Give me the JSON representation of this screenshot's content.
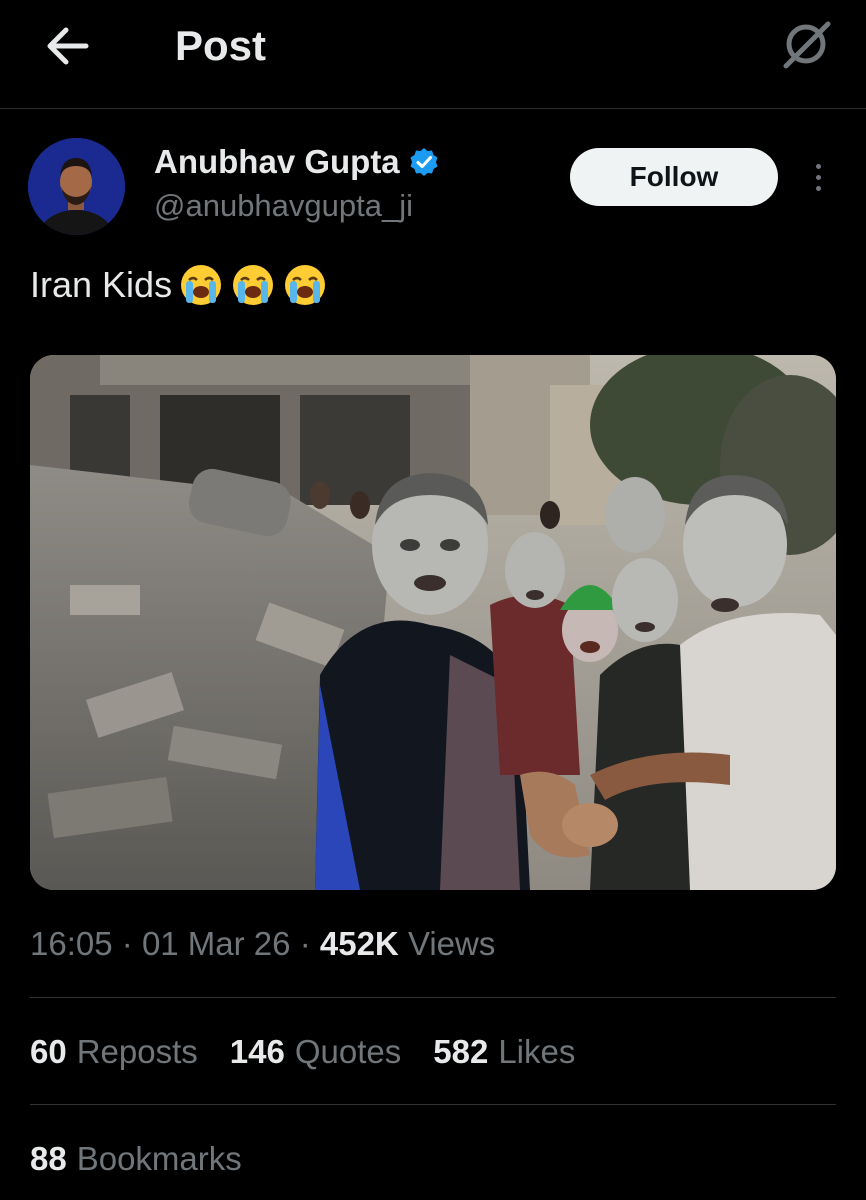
{
  "header": {
    "title": "Post",
    "back_icon": "arrow-left-icon",
    "grok_icon": "grok-icon"
  },
  "author": {
    "display_name": "Anubhav Gupta",
    "handle": "@anubhavgupta_ji",
    "verified_color": "#1d9bf0",
    "follow_label": "Follow"
  },
  "tweet": {
    "text": "Iran Kids",
    "emojis": [
      "loudly-crying-face",
      "loudly-crying-face",
      "loudly-crying-face"
    ]
  },
  "meta": {
    "time": "16:05",
    "date": "01 Mar 26",
    "views_count": "452K",
    "views_label": "Views",
    "separator": "·"
  },
  "stats": [
    {
      "count": "60",
      "label": "Reposts"
    },
    {
      "count": "146",
      "label": "Quotes"
    },
    {
      "count": "582",
      "label": "Likes"
    }
  ],
  "bookmarks": {
    "count": "88",
    "label": "Bookmarks"
  }
}
